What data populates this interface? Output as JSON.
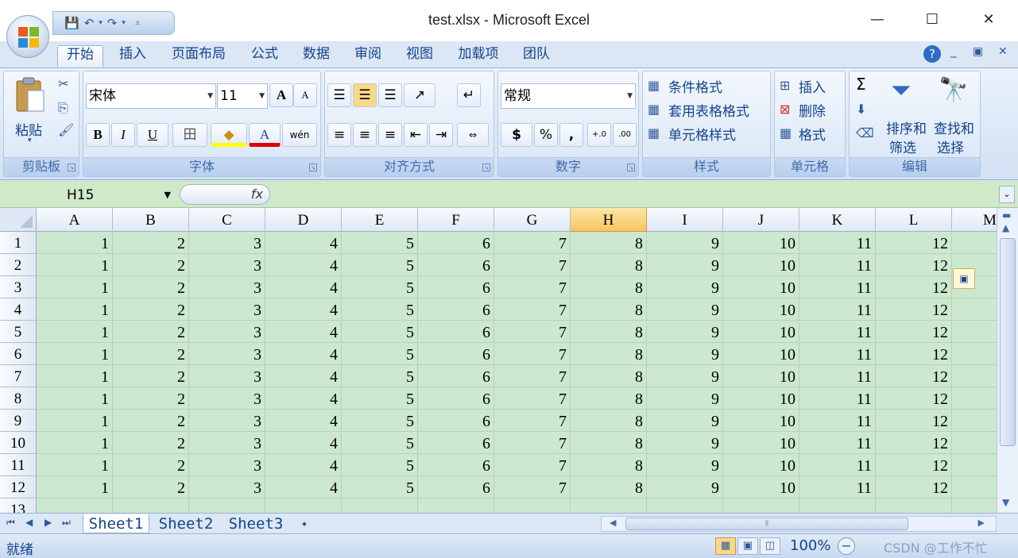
{
  "window": {
    "title": "test.xlsx - Microsoft Excel",
    "minimize": "—",
    "maximize": "☐",
    "close": "✕"
  },
  "qat": {
    "save": "💾",
    "undo": "↶",
    "undo_arrow": "▾",
    "redo": "↷",
    "redo_arrow": "▾",
    "customize": "⩡"
  },
  "tabs": [
    "开始",
    "插入",
    "页面布局",
    "公式",
    "数据",
    "审阅",
    "视图",
    "加载项",
    "团队"
  ],
  "ribbon_right": {
    "help": "?",
    "minimize": "_",
    "restore": "▣",
    "close": "✕"
  },
  "clipboard": {
    "paste": "粘贴",
    "paste_arrow": "▾",
    "label": "剪贴板"
  },
  "font": {
    "name": "宋体",
    "size": "11",
    "grow": "A",
    "shrink": "A",
    "bold": "B",
    "italic": "I",
    "underline": "U",
    "border": "田",
    "fill": "◆",
    "color": "A",
    "phonetic": "wén",
    "label": "字体"
  },
  "alignment": {
    "label": "对齐方式"
  },
  "number": {
    "format": "常规",
    "currency": "$",
    "percent": "%",
    "comma": ",",
    "inc_decimal": "+.0",
    "dec_decimal": ".00",
    "label": "数字"
  },
  "styles": {
    "conditional": "条件格式",
    "table": "套用表格格式",
    "cell": "单元格样式",
    "label": "样式"
  },
  "cells": {
    "insert": "插入",
    "delete": "删除",
    "format": "格式",
    "label": "单元格"
  },
  "editing": {
    "sum": "Σ",
    "sort": "排序和",
    "sort2": "筛选",
    "find": "查找和",
    "find2": "选择",
    "label": "编辑"
  },
  "formula_bar": {
    "name_box": "H15",
    "fx": "fx",
    "formula": "",
    "expand": "⌄"
  },
  "columns": [
    "A",
    "B",
    "C",
    "D",
    "E",
    "F",
    "G",
    "H",
    "I",
    "J",
    "K",
    "L",
    "M"
  ],
  "selected_column": "H",
  "rows": [
    {
      "num": "1",
      "values": [
        "1",
        "2",
        "3",
        "4",
        "5",
        "6",
        "7",
        "8",
        "9",
        "10",
        "11",
        "12"
      ]
    },
    {
      "num": "2",
      "values": [
        "1",
        "2",
        "3",
        "4",
        "5",
        "6",
        "7",
        "8",
        "9",
        "10",
        "11",
        "12"
      ]
    },
    {
      "num": "3",
      "values": [
        "1",
        "2",
        "3",
        "4",
        "5",
        "6",
        "7",
        "8",
        "9",
        "10",
        "11",
        "12"
      ]
    },
    {
      "num": "4",
      "values": [
        "1",
        "2",
        "3",
        "4",
        "5",
        "6",
        "7",
        "8",
        "9",
        "10",
        "11",
        "12"
      ]
    },
    {
      "num": "5",
      "values": [
        "1",
        "2",
        "3",
        "4",
        "5",
        "6",
        "7",
        "8",
        "9",
        "10",
        "11",
        "12"
      ]
    },
    {
      "num": "6",
      "values": [
        "1",
        "2",
        "3",
        "4",
        "5",
        "6",
        "7",
        "8",
        "9",
        "10",
        "11",
        "12"
      ]
    },
    {
      "num": "7",
      "values": [
        "1",
        "2",
        "3",
        "4",
        "5",
        "6",
        "7",
        "8",
        "9",
        "10",
        "11",
        "12"
      ]
    },
    {
      "num": "8",
      "values": [
        "1",
        "2",
        "3",
        "4",
        "5",
        "6",
        "7",
        "8",
        "9",
        "10",
        "11",
        "12"
      ]
    },
    {
      "num": "9",
      "values": [
        "1",
        "2",
        "3",
        "4",
        "5",
        "6",
        "7",
        "8",
        "9",
        "10",
        "11",
        "12"
      ]
    },
    {
      "num": "10",
      "values": [
        "1",
        "2",
        "3",
        "4",
        "5",
        "6",
        "7",
        "8",
        "9",
        "10",
        "11",
        "12"
      ]
    },
    {
      "num": "11",
      "values": [
        "1",
        "2",
        "3",
        "4",
        "5",
        "6",
        "7",
        "8",
        "9",
        "10",
        "11",
        "12"
      ]
    },
    {
      "num": "12",
      "values": [
        "1",
        "2",
        "3",
        "4",
        "5",
        "6",
        "7",
        "8",
        "9",
        "10",
        "11",
        "12"
      ]
    },
    {
      "num": "13",
      "values": [
        "",
        "",
        "",
        "",
        "",
        "",
        "",
        "",
        "",
        "",
        "",
        ""
      ]
    }
  ],
  "sheets": [
    "Sheet1",
    "Sheet2",
    "Sheet3"
  ],
  "active_sheet": "Sheet1",
  "status": {
    "ready": "就绪",
    "zoom": "100%",
    "watermark": "CSDN @工作不忙"
  }
}
